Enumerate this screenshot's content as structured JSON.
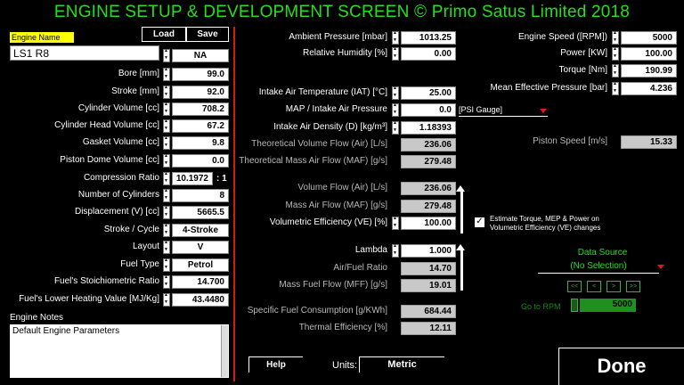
{
  "title": "ENGINE SETUP & DEVELOPMENT SCREEN  © Primo Satus Limited 2018",
  "toolbar": {
    "load": "Load",
    "save": "Save"
  },
  "engine": {
    "name_label": "Engine Name",
    "name_value": "LS1 R8",
    "aspiration": "NA",
    "bore": {
      "label": "Bore [mm]",
      "value": "99.0"
    },
    "stroke": {
      "label": "Stroke [mm]",
      "value": "92.0"
    },
    "cyl_volume": {
      "label": "Cylinder Volume [cc]",
      "value": "708.2"
    },
    "head_volume": {
      "label": "Cylinder Head Volume [cc]",
      "value": "67.2"
    },
    "gasket_volume": {
      "label": "Gasket Volume [cc]",
      "value": "9.8"
    },
    "piston_dome": {
      "label": "Piston Dome Volume [cc]",
      "value": "0.0"
    },
    "compression": {
      "label": "Compression Ratio",
      "value": "10.1972",
      "suffix": ": 1"
    },
    "num_cyl": {
      "label": "Number of Cylinders",
      "value": "8"
    },
    "displacement": {
      "label": "Displacement (V) [cc]",
      "value": "5665.5"
    },
    "stroke_cycle": {
      "label": "Stroke / Cycle",
      "value": "4-Stroke"
    },
    "layout": {
      "label": "Layout",
      "value": "V"
    },
    "fuel_type": {
      "label": "Fuel Type",
      "value": "Petrol"
    },
    "stoich": {
      "label": "Fuel's Stoichiometric Ratio",
      "value": "14.700"
    },
    "lhv": {
      "label": "Fuel's Lower Heating Value [MJ/Kg]",
      "value": "43.4480"
    },
    "notes_label": "Engine Notes",
    "notes_value": "Default Engine Parameters"
  },
  "atmos": {
    "ambient_pressure": {
      "label": "Ambient Pressure [mbar]",
      "value": "1013.25"
    },
    "humidity": {
      "label": "Relative Humidity [%]",
      "value": "0.00"
    },
    "iat": {
      "label": "Intake Air Temperature (IAT) [°C]",
      "value": "25.00"
    },
    "map": {
      "label": "MAP / Intake Air Pressure",
      "value": "0.0",
      "unit": "[PSI Gauge]"
    },
    "density": {
      "label": "Intake Air Density (D) [kg/m³]",
      "value": "1.18393"
    },
    "theo_vol_flow": {
      "label": "Theoretical Volume Flow (Air) [L/s]",
      "value": "236.06"
    },
    "theo_maf": {
      "label": "Theoretical Mass Air Flow (MAF) [g/s]",
      "value": "279.48"
    },
    "vol_flow": {
      "label": "Volume Flow (Air) [L/s]",
      "value": "236.06"
    },
    "maf": {
      "label": "Mass Air Flow (MAF) [g/s]",
      "value": "279.48"
    },
    "ve": {
      "label": "Volumetric Efficiency (VE) [%]",
      "value": "100.00"
    },
    "lambda": {
      "label": "Lambda",
      "value": "1.000"
    },
    "afr": {
      "label": "Air/Fuel Ratio",
      "value": "14.70"
    },
    "mff": {
      "label": "Mass Fuel Flow (MFF) [g/s]",
      "value": "19.01"
    },
    "sfc": {
      "label": "Specific Fuel Consumption [g/KWh]",
      "value": "684.44"
    },
    "thermal_eff": {
      "label": "Thermal Efficiency [%]",
      "value": "12.11"
    }
  },
  "perf": {
    "speed": {
      "label": "Engine Speed ([RPM])",
      "value": "5000"
    },
    "power": {
      "label": "Power [KW]",
      "value": "100.00"
    },
    "torque": {
      "label": "Torque [Nm]",
      "value": "190.99"
    },
    "mep": {
      "label": "Mean Effective Pressure [bar]",
      "value": "4.236"
    },
    "piston_speed": {
      "label": "Piston Speed [m/s]",
      "value": "15.33"
    },
    "estimate_checkbox": "Estimate Torque, MEP & Power on Volumetric Efficiency (VE) changes",
    "data_source_label": "Data Source",
    "data_source_value": "(No Selection)",
    "nav": [
      "<<",
      "<",
      ">",
      ">>"
    ],
    "goto_label": "Go to RPM",
    "goto_value": "5000"
  },
  "footer": {
    "help": "Help",
    "units_label": "Units:",
    "units_value": "Metric",
    "done": "Done"
  }
}
